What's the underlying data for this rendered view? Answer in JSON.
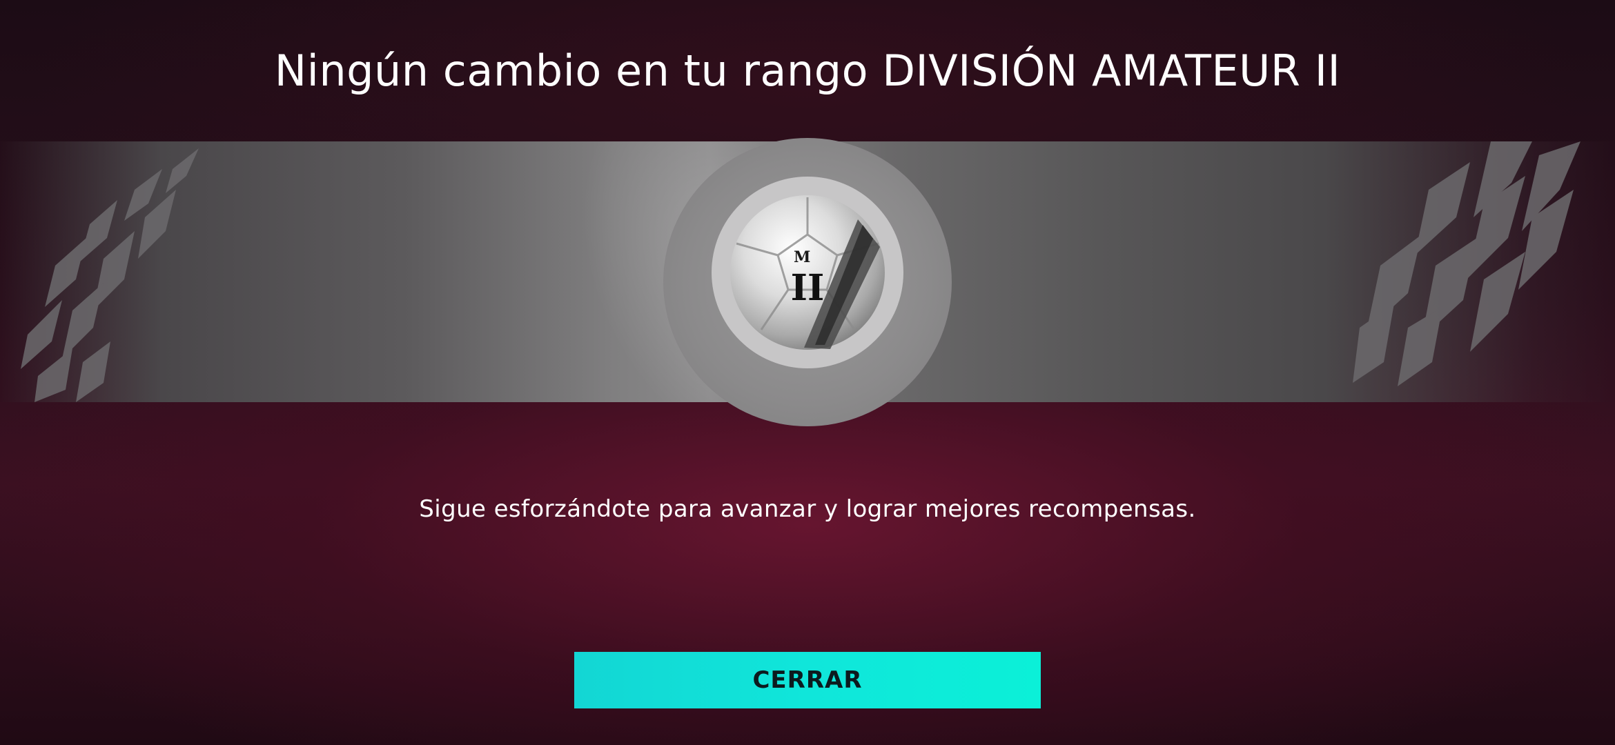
{
  "rank_screen": {
    "title": "Ningún cambio en tu rango DIVISIÓN AMATEUR II",
    "badge": {
      "icon": "amateur-division-ball-badge",
      "tier_numeral": "II"
    },
    "message": "Sigue esforzándote para avanzar y lograr mejores recompensas.",
    "close_label": "CERRAR"
  },
  "colors": {
    "background": "#2a0f1c",
    "band": "#807f80",
    "button": "#10e6da",
    "button_text": "#0c1a1e",
    "text": "#ffffff"
  }
}
